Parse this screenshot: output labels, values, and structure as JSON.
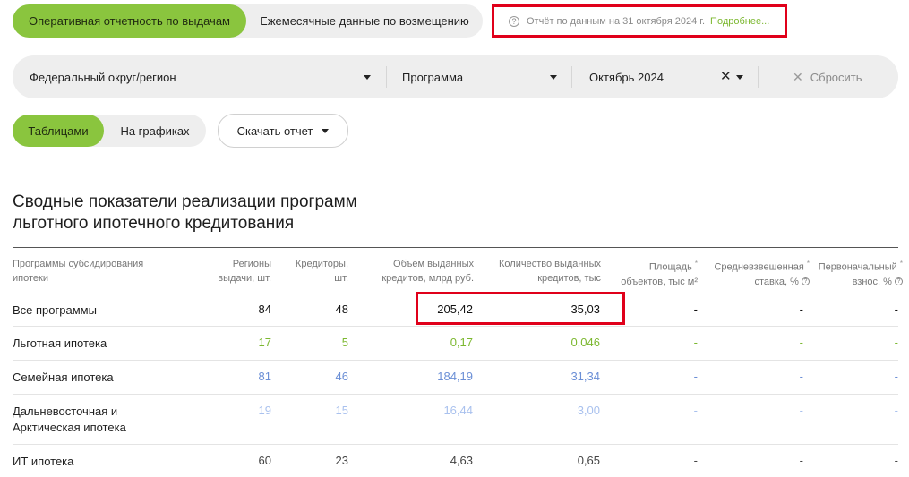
{
  "report_tabs": {
    "active": "Оперативная отчетность по выдачам",
    "inactive": "Ежемесячные данные по возмещению"
  },
  "notice": {
    "text": "Отчёт по данным на 31 октября 2024 г.",
    "link": "Подробнее..."
  },
  "filters": {
    "region": "Федеральный округ/регион",
    "program": "Программа",
    "month": "Октябрь 2024",
    "reset": "Сбросить"
  },
  "view": {
    "tables": "Таблицами",
    "charts": "На графиках",
    "download": "Скачать отчет"
  },
  "title": {
    "line1": "Сводные показатели реализации программ",
    "line2": "льготного ипотечного кредитования"
  },
  "table": {
    "headers": {
      "program": [
        "Программы субсидирования",
        "ипотеки"
      ],
      "regions": [
        "Регионы",
        "выдачи, шт."
      ],
      "creditors": [
        "Кредиторы,",
        "шт."
      ],
      "volume": [
        "Объем выданных",
        "кредитов, млрд руб."
      ],
      "count": [
        "Количество выданных",
        "кредитов, тыс"
      ],
      "area": [
        "Площадь",
        "объектов, тыс м²"
      ],
      "rate": [
        "Средневзвешенная",
        "ставка, %"
      ],
      "down": [
        "Первоначальный",
        "взнос, %"
      ]
    },
    "rows": [
      {
        "name": "Все программы",
        "regions": "84",
        "creditors": "48",
        "volume": "205,42",
        "count": "35,03",
        "area": "-",
        "rate": "-",
        "down": "-"
      },
      {
        "name": "Льготная ипотека",
        "regions": "17",
        "creditors": "5",
        "volume": "0,17",
        "count": "0,046",
        "area": "-",
        "rate": "-",
        "down": "-"
      },
      {
        "name": "Семейная ипотека",
        "regions": "81",
        "creditors": "46",
        "volume": "184,19",
        "count": "31,34",
        "area": "-",
        "rate": "-",
        "down": "-"
      },
      {
        "name": "Дальневосточная и Арктическая ипотека",
        "regions": "19",
        "creditors": "15",
        "volume": "16,44",
        "count": "3,00",
        "area": "-",
        "rate": "-",
        "down": "-"
      },
      {
        "name": "ИТ ипотека",
        "regions": "60",
        "creditors": "23",
        "volume": "4,63",
        "count": "0,65",
        "area": "-",
        "rate": "-",
        "down": "-"
      }
    ]
  },
  "colors": {
    "accent_green": "#8ac53e",
    "highlight_red": "#e0001a",
    "link_green": "#7cb830",
    "value_blue": "#6b8fd6"
  }
}
